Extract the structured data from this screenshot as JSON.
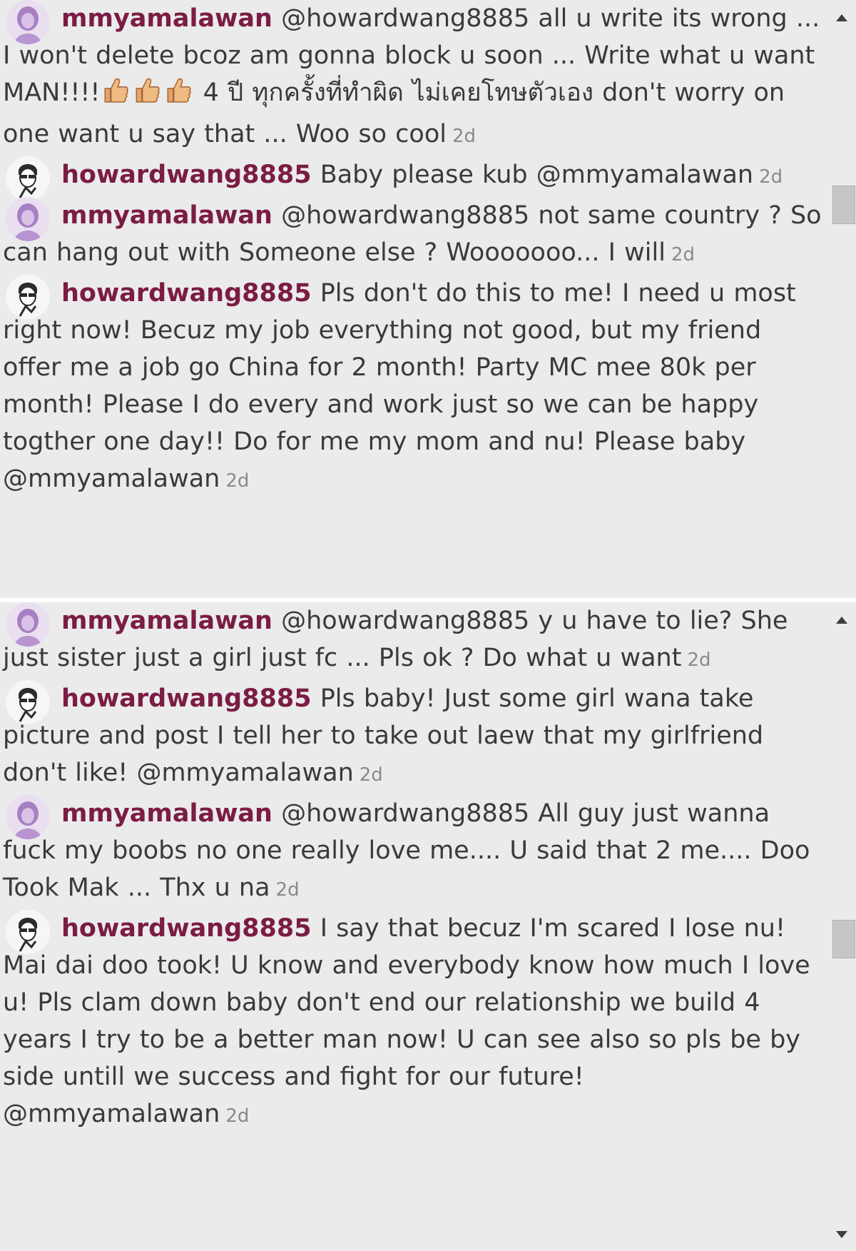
{
  "panels": [
    {
      "comments": [
        {
          "username": "mmyamalawan",
          "avatar": "user-avatar-icon",
          "segments": [
            {
              "text": " @howardwang8885 all u write its wrong ... I won't delete bcoz am gonna block u soon ... Write what u want MAN!!!!"
            },
            {
              "emoji": "thumbs-up-icon",
              "count": 3
            },
            {
              "text": " 4 ปี ทุกครั้งที่ทำผิด ไม่เคยโทษตัวเอง don't worry on one want u say that ... Woo so cool"
            }
          ],
          "time": "2d"
        },
        {
          "username": "howardwang8885",
          "avatar": "user-avatar-icon",
          "segments": [
            {
              "text": " Baby please kub @mmyamalawan"
            }
          ],
          "time": "2d"
        },
        {
          "username": "mmyamalawan",
          "avatar": "user-avatar-icon",
          "segments": [
            {
              "text": " @howardwang8885 not same country ? So can hang out with Someone else ? Wooooooo... I will"
            }
          ],
          "time": "2d"
        },
        {
          "username": "howardwang8885",
          "avatar": "user-avatar-icon",
          "segments": [
            {
              "text": " Pls don't do this to me! I need u most right now! Becuz my job everything not good, but my friend offer me a job go China for 2 month! Party MC mee 80k per month! Please I do every and work just so we can be happy togther one day!! Do for me my mom and nu! Please baby @mmyamalawan"
            }
          ],
          "time": "2d"
        }
      ]
    },
    {
      "comments": [
        {
          "username": "mmyamalawan",
          "avatar": "user-avatar-icon",
          "segments": [
            {
              "text": " @howardwang8885 y u have to lie? She just sister just a girl just fc ... Pls ok ? Do what u want"
            }
          ],
          "time": "2d"
        },
        {
          "username": "howardwang8885",
          "avatar": "user-avatar-icon",
          "segments": [
            {
              "text": " Pls baby! Just some girl wana take picture and post I tell her to take out laew that my girlfriend don't like! @mmyamalawan"
            }
          ],
          "time": "2d"
        },
        {
          "username": "mmyamalawan",
          "avatar": "user-avatar-icon",
          "segments": [
            {
              "text": " @howardwang8885 All guy just wanna fuck my boobs no one really love me.... U said that 2 me.... Doo Took Mak ... Thx u na"
            }
          ],
          "time": "2d"
        },
        {
          "username": "howardwang8885",
          "avatar": "user-avatar-icon",
          "segments": [
            {
              "text": " I say that becuz I'm scared I lose nu! Mai dai doo took! U know and everybody know how much I love u! Pls clam down baby don't end our relationship we build 4 years I try to be a better man now! U can see also so pls be by side untill we success and fight for our future! @mmyamalawan"
            }
          ],
          "time": "2d"
        }
      ]
    }
  ],
  "scrollbar": {
    "up_icon": "arrow-up-icon",
    "down_icon": "arrow-down-icon",
    "panel_positions": [
      0.32,
      0.52
    ]
  },
  "colors": {
    "background": "#ebebeb",
    "username": "#7b1c44",
    "text": "#3a3a3a",
    "timestamp": "#8a8a8a"
  }
}
